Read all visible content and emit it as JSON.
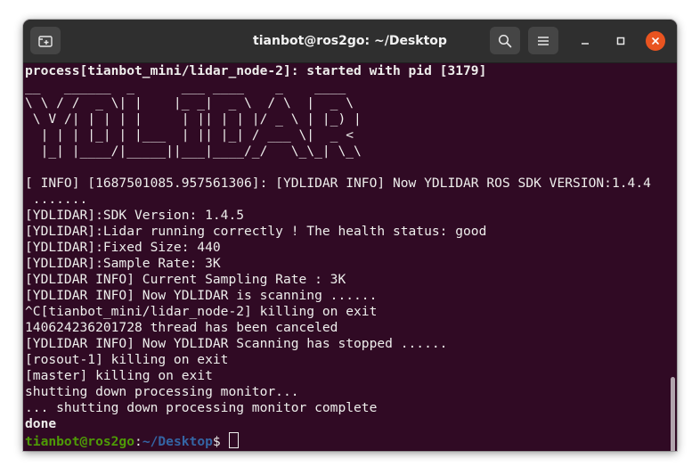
{
  "window": {
    "title": "tianbot@ros2go: ~/Desktop",
    "colors": {
      "terminal_bg": "#300a24",
      "titlebar_bg": "#2f2f2f",
      "close_button": "#e95420",
      "prompt_user": "#4e9a06",
      "prompt_path": "#3465a4",
      "text": "#eeeeec"
    },
    "icons": {
      "new_tab": "new-tab-icon",
      "search": "search-icon",
      "menu": "hamburger-menu-icon",
      "minimize": "minimize-icon",
      "maximize": "maximize-icon",
      "close": "close-icon"
    }
  },
  "terminal": {
    "lines": [
      "process[tianbot_mini/lidar_node-2]: started with pid [3179]",
      "__   ______  _      ___ ____    _    ____",
      "\\ \\ / /  _ \\| |    |_ _|  _ \\  / \\  |  _ \\",
      " \\ V /| | | | |     | || | | |/ _ \\ | |_) |",
      "  | | | |_| | |___  | || |_| / ___ \\|  _ <",
      "  |_| |____/|_____||___|____/_/   \\_\\_| \\_\\",
      "",
      "[ INFO] [1687501085.957561306]: [YDLIDAR INFO] Now YDLIDAR ROS SDK VERSION:1.4.4",
      " .......",
      "[YDLIDAR]:SDK Version: 1.4.5",
      "[YDLIDAR]:Lidar running correctly ! The health status: good",
      "[YDLIDAR]:Fixed Size: 440",
      "[YDLIDAR]:Sample Rate: 3K",
      "[YDLIDAR INFO] Current Sampling Rate : 3K",
      "[YDLIDAR INFO] Now YDLIDAR is scanning ......",
      "^C[tianbot_mini/lidar_node-2] killing on exit",
      "140624236201728 thread has been canceled",
      "[YDLIDAR INFO] Now YDLIDAR Scanning has stopped ......",
      "[rosout-1] killing on exit",
      "[master] killing on exit",
      "shutting down processing monitor...",
      "... shutting down processing monitor complete",
      "done"
    ],
    "prompt": {
      "user_host": "tianbot@ros2go",
      "separator": ":",
      "path": "~/Desktop",
      "symbol": "$ "
    }
  }
}
